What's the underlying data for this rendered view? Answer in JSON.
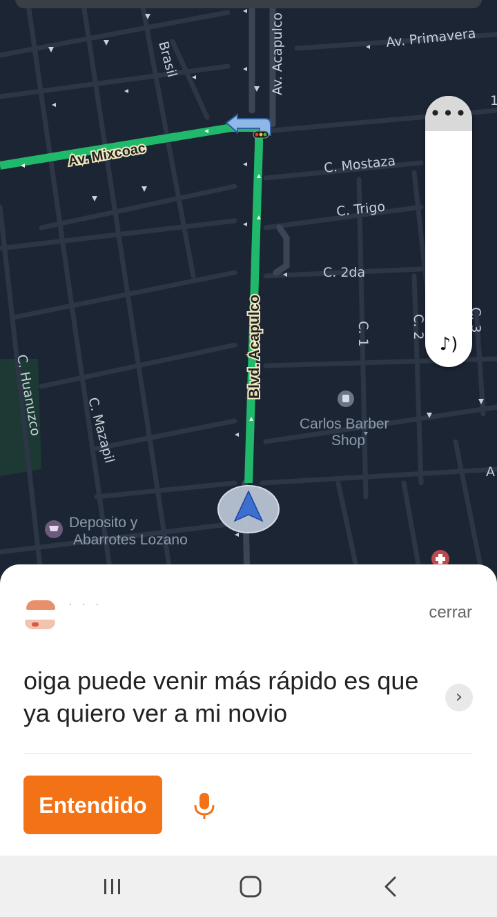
{
  "map": {
    "streets": {
      "av_primavera": "Av. Primavera",
      "av_acapulco": "Av. Acapulco",
      "brasil": "Brasil",
      "av_mixcoac": "Av. Mixcoac",
      "c_mostaza": "C. Mostaza",
      "c_trigo": "C. Trigo",
      "c_2da": "C. 2da",
      "c_1": "C. 1",
      "c_2": "C. 2",
      "c_3": "C. 3",
      "blvd_acapulco": "Blvd. Acapulco",
      "c_huanuzco": "C. Huanuzco",
      "c_mazapil": "C. Mazapil",
      "edge_a": "A",
      "edge_1": "1"
    },
    "pois": {
      "barber_line1": "Carlos Barber",
      "barber_line2": "Shop",
      "deposito_line1": "Deposito y",
      "deposito_line2": "Abarrotes Lozano"
    },
    "colors": {
      "route": "#20b86a",
      "background": "#1c2533",
      "accent": "#f47216"
    }
  },
  "volume_panel": {
    "menu_icon": "more-horizontal-icon",
    "sound_icon": "music-note-sound-icon"
  },
  "message": {
    "close_label": "cerrar",
    "text": "oiga puede venir más rápido es que ya quiero ver a mi novio",
    "ok_label": "Entendido",
    "sender_masked": "· · ·"
  },
  "navbar": {
    "recents_icon": "recent-apps-icon",
    "home_icon": "home-icon",
    "back_icon": "back-icon"
  }
}
